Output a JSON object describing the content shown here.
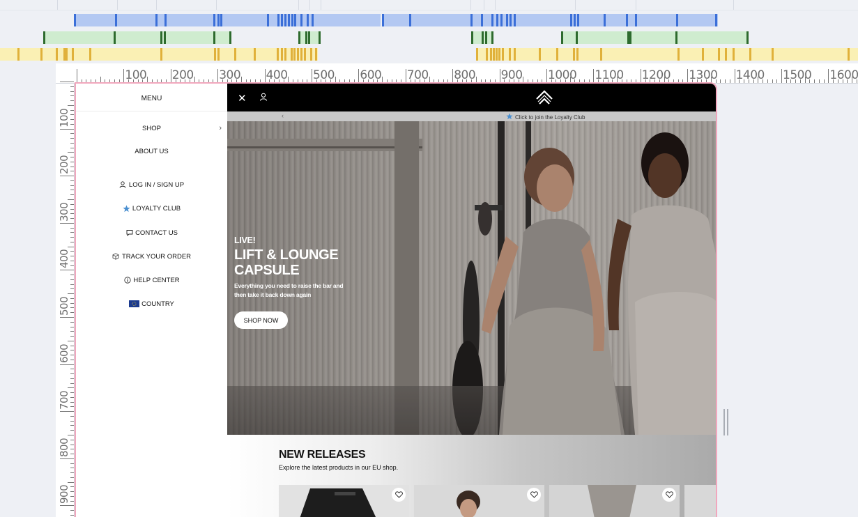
{
  "ruler": {
    "h_labels": [
      "100",
      "200",
      "300",
      "400",
      "500",
      "600",
      "700",
      "800",
      "900",
      "1000",
      "1100",
      "1200",
      "1300",
      "1400",
      "1500",
      "1600"
    ],
    "v_labels": [
      "100",
      "200",
      "300",
      "400",
      "500",
      "600",
      "700",
      "800",
      "900"
    ]
  },
  "menu": {
    "title": "MENU",
    "items": [
      {
        "label": "SHOP",
        "icon": "chevron-right-icon"
      },
      {
        "label": "ABOUT US"
      },
      {
        "label": "LOG IN / SIGN UP",
        "icon": "user-icon"
      },
      {
        "label": "LOYALTY CLUB",
        "icon": "star-icon"
      },
      {
        "label": "CONTACT US",
        "icon": "chat-bubble-icon"
      },
      {
        "label": "TRACK YOUR ORDER",
        "icon": "package-icon"
      },
      {
        "label": "HELP CENTER",
        "icon": "info-icon"
      },
      {
        "label": "COUNTRY",
        "icon": "eu-flag-icon"
      }
    ]
  },
  "topbar": {
    "close_icon": "close-icon",
    "account_icon": "user-icon",
    "logo_icon": "brand-chevron-logo"
  },
  "promo": {
    "prev_arrow": "‹",
    "text": "Click to join the Loyalty Club",
    "icon": "star-icon"
  },
  "hero": {
    "tag": "LIVE!",
    "title": "LIFT & LOUNGE\nCAPSULE",
    "subtitle": "Everything you need to raise the bar and then take it back down again",
    "cta": "SHOP NOW"
  },
  "new_releases": {
    "title": "NEW RELEASES",
    "subtitle": "Explore the latest products in our EU shop."
  },
  "colors": {
    "timeline_blue": "#b3c8f2",
    "timeline_blue_mark": "#3b6fd8",
    "timeline_green": "#cfeccf",
    "timeline_green_mark": "#2e6b2e",
    "timeline_yellow": "#faf0b4",
    "timeline_yellow_mark": "#e0b13a",
    "viewport_border": "#f1a7bd",
    "loyalty_star": "#4a8fd0"
  }
}
